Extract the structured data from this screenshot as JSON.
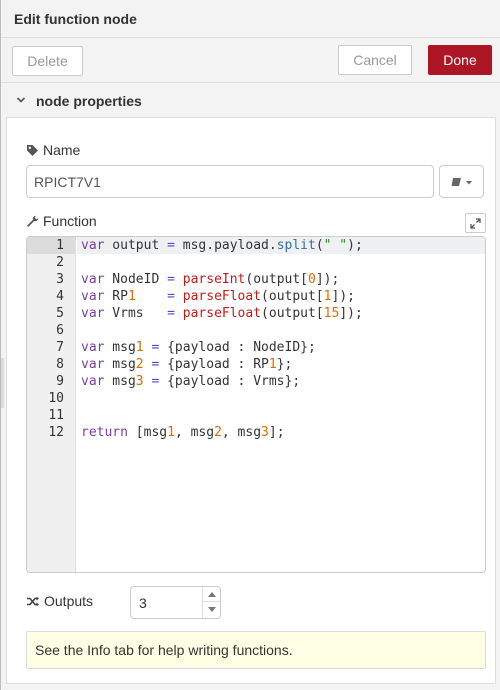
{
  "dialog": {
    "title": "Edit function node"
  },
  "toolbar": {
    "delete_label": "Delete",
    "cancel_label": "Cancel",
    "done_label": "Done"
  },
  "section": {
    "label": "node properties"
  },
  "name": {
    "label": "Name",
    "value": "RPICT7V1"
  },
  "function": {
    "label": "Function",
    "lines": [
      "var output = msg.payload.split(\" \");",
      "",
      "var NodeID = parseInt(output[0]);",
      "var RP1    = parseFloat(output[1]);",
      "var Vrms   = parseFloat(output[15]);",
      "",
      "var msg1 = {payload : NodeID};",
      "var msg2 = {payload : RP1};",
      "var msg3 = {payload : Vrms};",
      "",
      "",
      "return [msg1, msg2, msg3];"
    ]
  },
  "outputs": {
    "label": "Outputs",
    "value": "3"
  },
  "tip": "See the Info tab for help writing functions.",
  "colors": {
    "done": "#AD1625",
    "tip_bg": "#ffffe6"
  },
  "icons": {
    "section": "chevron-down-icon",
    "name": "tag-icon",
    "function": "wrench-icon",
    "outputs": "shuffle-icon",
    "library": "book-icon",
    "expand": "expand-icon"
  }
}
